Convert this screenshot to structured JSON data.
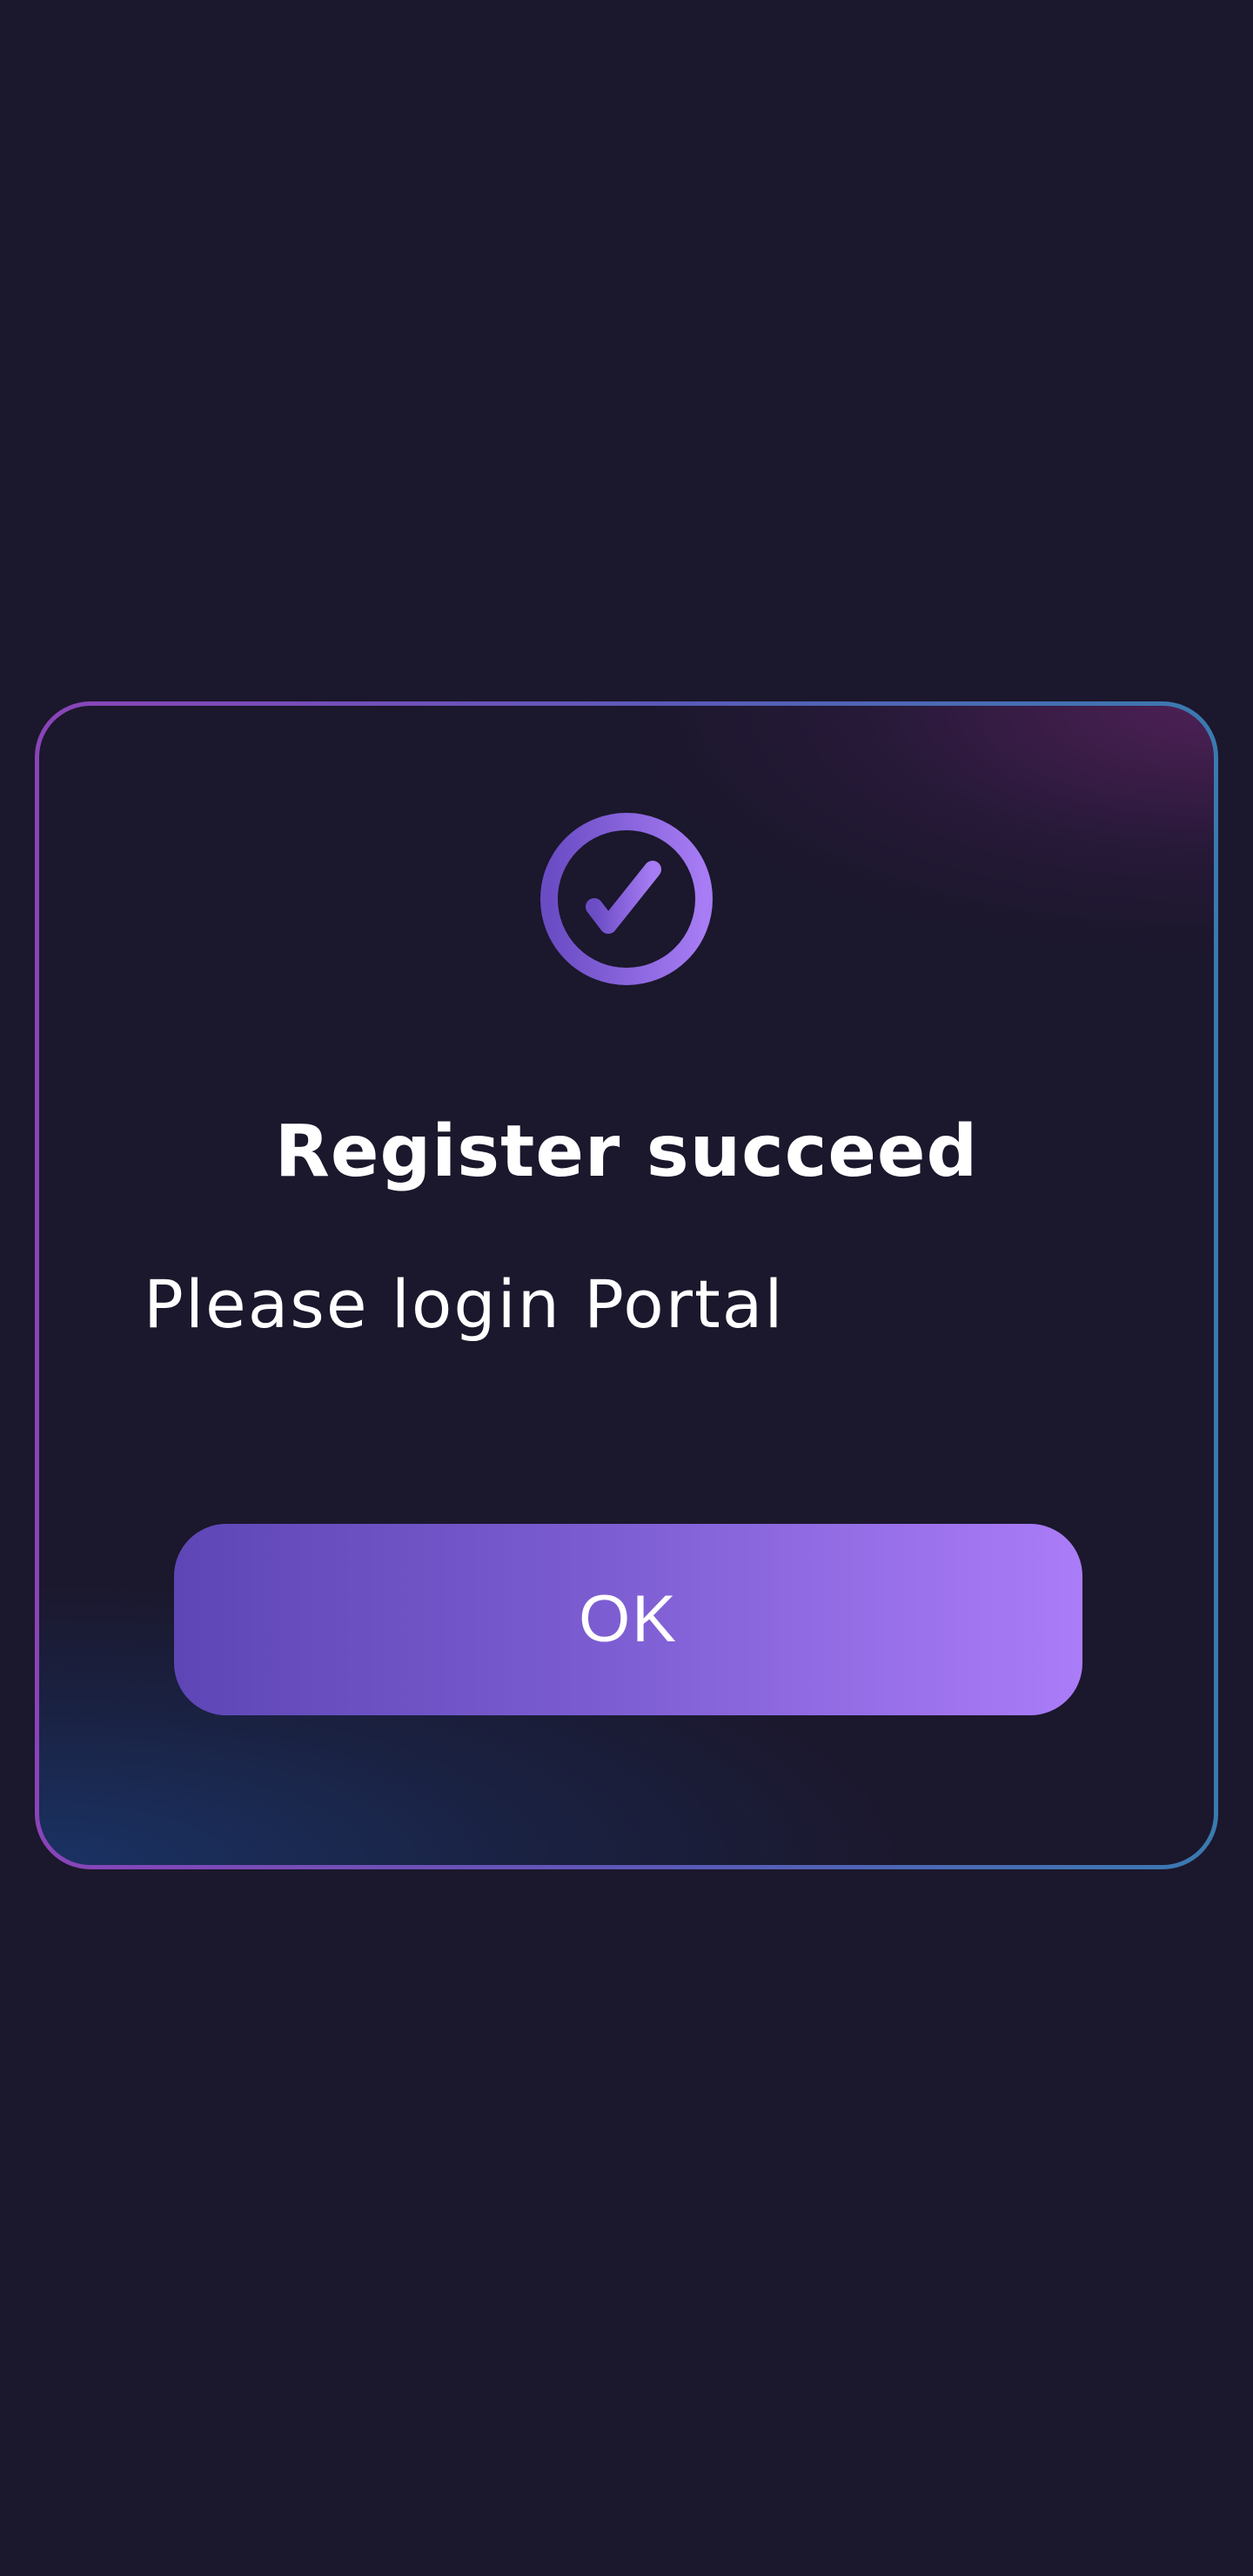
{
  "dialog": {
    "icon": "check-circle-icon",
    "title": "Register succeed",
    "message": "Please login Portal",
    "ok_label": "OK"
  },
  "colors": {
    "background": "#1b172c",
    "accent_start": "#5e46b6",
    "accent_end": "#ab7cf8",
    "border_start": "#8a44b8",
    "border_end": "#3a7ab0",
    "text": "#ffffff"
  }
}
